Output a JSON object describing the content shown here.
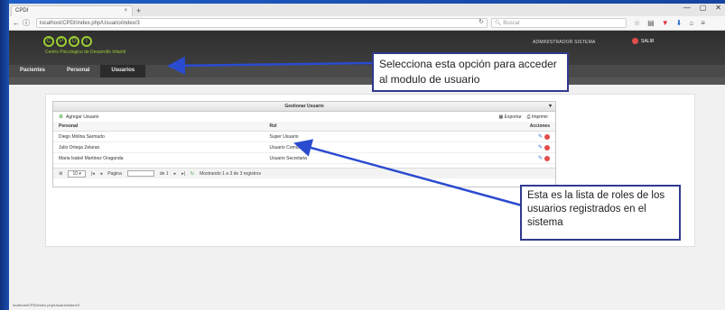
{
  "browser": {
    "tab_title": "CPDI",
    "tab_close": "×",
    "new_tab": "+",
    "window_controls": [
      "—",
      "▢",
      "✕"
    ],
    "url": "localhost/CPDI/index.php/Usuario/index/3",
    "search_placeholder": "Buscar",
    "status_url": "localhost/CPDI/index.php/Usuario/index/3"
  },
  "app": {
    "logo_letters": [
      "C",
      "P",
      "D",
      "I"
    ],
    "logo_text": "Centro Psicologico de Desarrollo Infantil",
    "user_role": "ADMINISTRADOR SISTEMA",
    "logout_label": "SALIR",
    "menu": [
      "Pacientes",
      "Personal",
      "Usuarios"
    ],
    "active_menu": "Usuarios"
  },
  "panel": {
    "title": "Gestionar Usuario",
    "add_label": "Agregar Usuario",
    "export_label": "Exportar",
    "print_label": "Imprimir",
    "columns": [
      "Personal",
      "Rol",
      "Acciones"
    ],
    "rows": [
      {
        "personal": "Diego Molina Sarmudo",
        "rol": "Super Usuario"
      },
      {
        "personal": "Julio Ortega Zelaran",
        "rol": "Usuario Comun"
      },
      {
        "personal": "Maria Isabel Martinez Oraganda",
        "rol": "Usuario Secretaria"
      }
    ],
    "pager": {
      "page_size": "10",
      "page_label": "Pagina",
      "of_label": "de 1",
      "summary": "Mostrando 1 a 3 de 3 registros"
    }
  },
  "callouts": {
    "menu_callout": "Selecciona esta opción para acceder al modulo de usuario",
    "roles_callout": "Esta es la lista de roles de los usuarios registrados en el sistema"
  },
  "colors": {
    "slide_background": "#1a4fb0",
    "callout_border": "#2f3a8f",
    "arrow": "#2a4bd0",
    "logo_green": "#9acd32"
  }
}
